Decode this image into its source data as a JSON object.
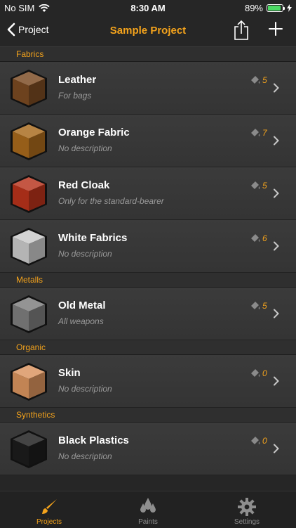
{
  "status_bar": {
    "carrier": "No SIM",
    "time": "8:30 AM",
    "battery": "89%",
    "battery_level": 0.89
  },
  "nav": {
    "back_label": "Project",
    "title": "Sample Project"
  },
  "sections": [
    {
      "title": "Fabrics",
      "items": [
        {
          "name": "Leather",
          "description": "For bags",
          "count": "5"
        },
        {
          "name": "Orange Fabric",
          "description": "No description",
          "count": "7"
        },
        {
          "name": "Red Cloak",
          "description": "Only for the standard-bearer",
          "count": "5"
        },
        {
          "name": "White Fabrics",
          "description": "No description",
          "count": "6"
        }
      ]
    },
    {
      "title": "Metalls",
      "items": [
        {
          "name": "Old Metal",
          "description": "All weapons",
          "count": "5"
        }
      ]
    },
    {
      "title": "Organic",
      "items": [
        {
          "name": "Skin",
          "description": "No description",
          "count": "0"
        }
      ]
    },
    {
      "title": "Synthetics",
      "items": [
        {
          "name": "Black Plastics",
          "description": "No description",
          "count": "0"
        }
      ]
    }
  ],
  "tabs": [
    {
      "label": "Projects",
      "icon": "brush-icon",
      "active": true
    },
    {
      "label": "Paints",
      "icon": "drops-icon",
      "active": false
    },
    {
      "label": "Settings",
      "icon": "gear-icon",
      "active": false
    }
  ],
  "colors": {
    "accent": "#f4a31c",
    "background": "#262626",
    "thumbs": [
      "#7a4a22",
      "#a8691c",
      "#b8331b",
      "#c9c9c9",
      "#7d7d7d",
      "#d9935e",
      "#1c1c1c"
    ]
  }
}
